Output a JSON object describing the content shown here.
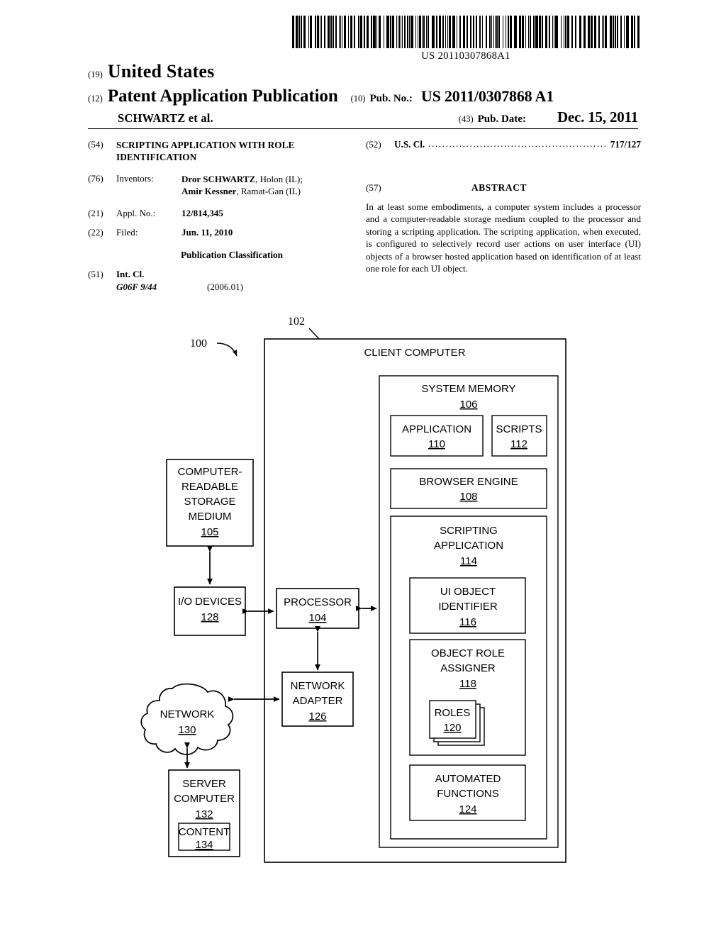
{
  "barcode": {
    "number": "US 20110307868A1",
    "icon": "barcode-icon"
  },
  "masthead": {
    "code_19": "(19)",
    "country": "United States",
    "code_12": "(12)",
    "doc_type": "Patent Application Publication",
    "authors": "SCHWARTZ et al.",
    "code_10": "(10)",
    "pub_no_label": "Pub. No.:",
    "pub_no_value": "US 2011/0307868 A1",
    "code_43": "(43)",
    "pub_date_label": "Pub. Date:",
    "pub_date_value": "Dec. 15, 2011"
  },
  "biblio": {
    "code_54": "(54)",
    "title": "SCRIPTING APPLICATION WITH ROLE IDENTIFICATION",
    "code_76": "(76)",
    "inventors_label": "Inventors:",
    "inventor_1_name": "Dror SCHWARTZ",
    "inventor_1_city": ", Holon (IL);",
    "inventor_2_name": "Amir Kessner",
    "inventor_2_city": ", Ramat-Gan (IL)",
    "code_21": "(21)",
    "appl_no_label": "Appl. No.:",
    "appl_no_value": "12/814,345",
    "code_22": "(22)",
    "filed_label": "Filed:",
    "filed_value": "Jun. 11, 2010",
    "pub_class_heading": "Publication Classification",
    "code_51": "(51)",
    "int_cl_label": "Int. Cl.",
    "int_cl_code": "G06F  9/44",
    "int_cl_year": "(2006.01)"
  },
  "biblio_right": {
    "code_52": "(52)",
    "us_cl_label": "U.S. Cl.",
    "us_cl_dots": "........................................................",
    "us_cl_value": "717/127",
    "code_57": "(57)",
    "abstract_title": "ABSTRACT",
    "abstract_text": "In at least some embodiments, a computer system includes a processor and a computer-readable storage medium coupled to the processor and storing a scripting application. The scripting application, when executed, is configured to selectively record user actions on user interface (UI) objects of a browser hosted application based on identification of at least one role for each UI object."
  },
  "figure": {
    "ref_100": "100",
    "ref_102": "102",
    "client_computer": {
      "label": "CLIENT COMPUTER"
    },
    "system_memory": {
      "label": "SYSTEM MEMORY",
      "num": "106"
    },
    "application": {
      "label": "APPLICATION",
      "num": "110"
    },
    "scripts": {
      "label": "SCRIPTS",
      "num": "112"
    },
    "browser_engine": {
      "label": "BROWSER ENGINE",
      "num": "108"
    },
    "scripting_application": {
      "label_1": "SCRIPTING",
      "label_2": "APPLICATION",
      "num": "114"
    },
    "ui_object_identifier": {
      "label_1": "UI OBJECT",
      "label_2": "IDENTIFIER",
      "num": "116"
    },
    "object_role_assigner": {
      "label_1": "OBJECT ROLE",
      "label_2": "ASSIGNER",
      "num": "118"
    },
    "roles": {
      "label": "ROLES",
      "num": "120"
    },
    "automated_functions": {
      "label_1": "AUTOMATED",
      "label_2": "FUNCTIONS",
      "num": "124"
    },
    "storage_medium": {
      "label_1": "COMPUTER-",
      "label_2": "READABLE",
      "label_3": "STORAGE",
      "label_4": "MEDIUM",
      "num": "105"
    },
    "io_devices": {
      "label": "I/O DEVICES",
      "num": "128"
    },
    "processor": {
      "label": "PROCESSOR",
      "num": "104"
    },
    "network": {
      "label": "NETWORK",
      "num": "130"
    },
    "network_adapter": {
      "label_1": "NETWORK",
      "label_2": "ADAPTER",
      "num": "126"
    },
    "server_computer": {
      "label_1": "SERVER",
      "label_2": "COMPUTER",
      "num": "132"
    },
    "content": {
      "label": "CONTENT",
      "num": "134"
    }
  }
}
